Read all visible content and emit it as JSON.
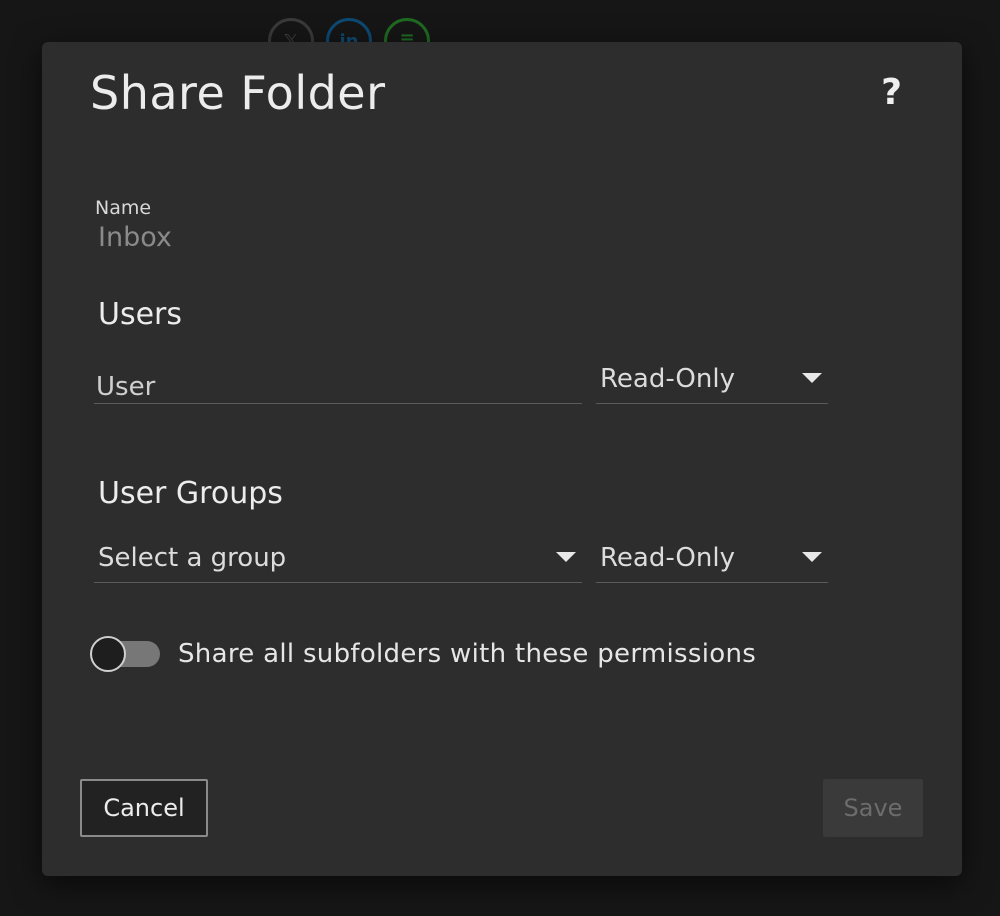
{
  "dialog": {
    "title": "Share Folder",
    "help_label": "?"
  },
  "name_field": {
    "label": "Name",
    "value": "Inbox"
  },
  "users_section": {
    "heading": "Users",
    "user_input_placeholder": "User",
    "permission_value": "Read-Only"
  },
  "groups_section": {
    "heading": "User Groups",
    "group_select_value": "Select a group",
    "permission_value": "Read-Only"
  },
  "subfolders_toggle": {
    "label": "Share all subfolders with these permissions",
    "checked": false
  },
  "footer": {
    "cancel_label": "Cancel",
    "save_label": "Save",
    "save_enabled": false
  },
  "colors": {
    "dialog_background": "#2d2d2d",
    "page_background": "#161616",
    "text_primary": "#ececec",
    "text_muted": "#8a8a8a",
    "save_disabled": "#6c6c6c"
  }
}
